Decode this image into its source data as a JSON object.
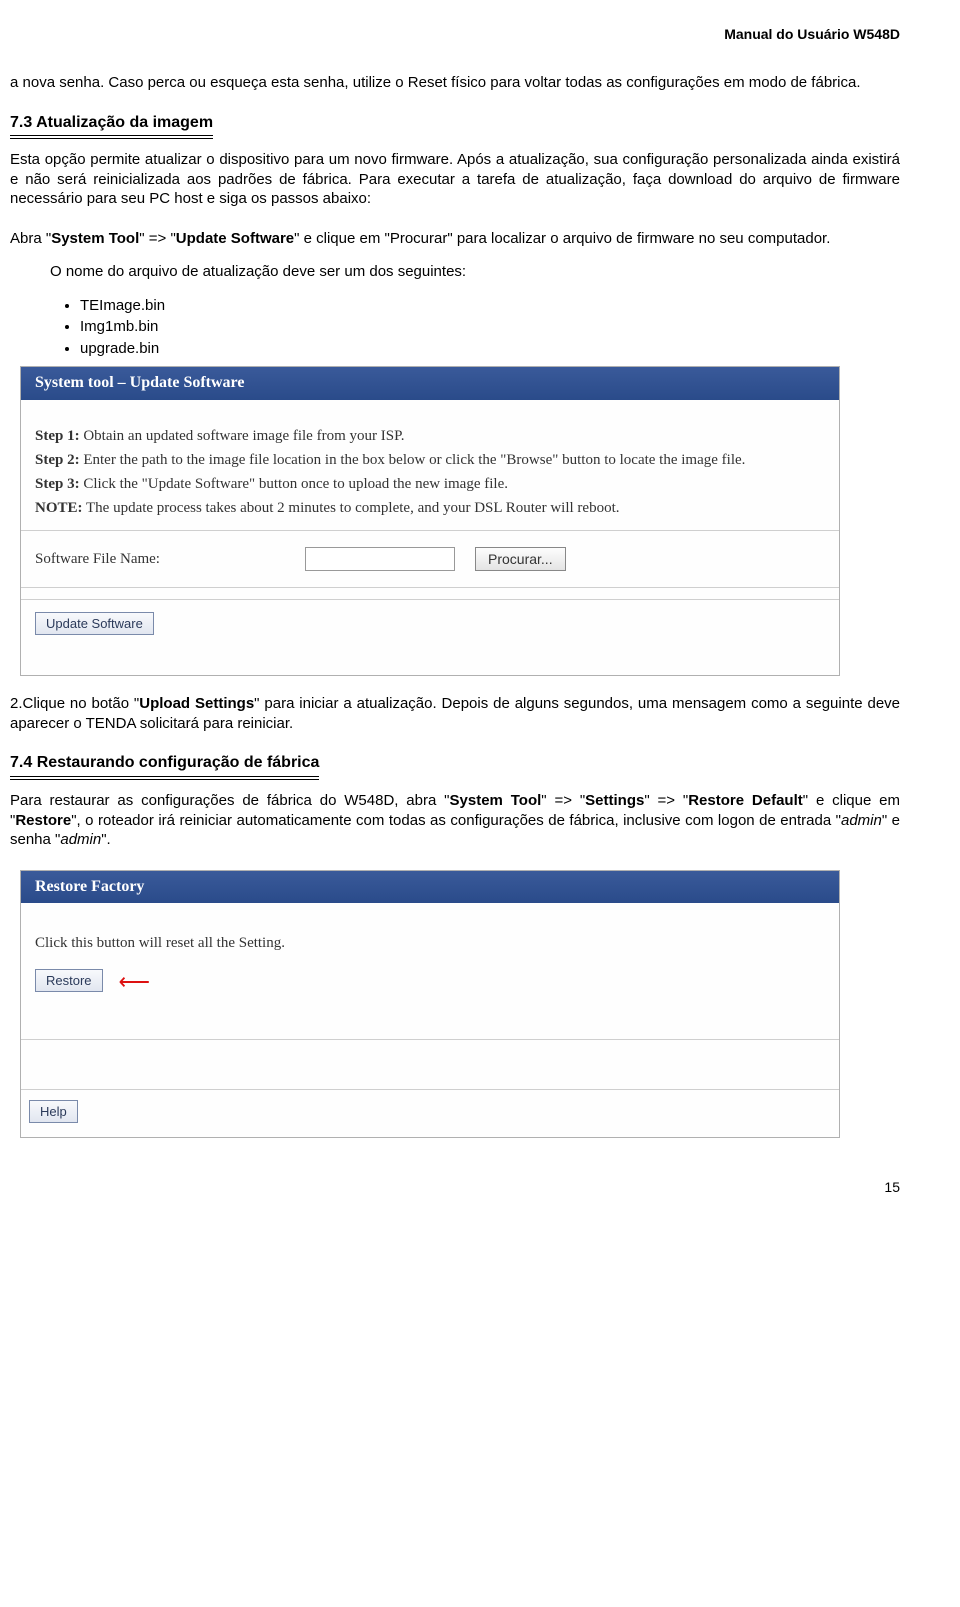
{
  "header": {
    "title": "Manual do Usuário W548D"
  },
  "intro": {
    "p1": "a nova senha. Caso perca ou esqueça esta senha, utilize o Reset físico para voltar todas as configurações em modo de fábrica."
  },
  "section73": {
    "title": "7.3 Atualização da imagem",
    "p1": "Esta opção permite atualizar o dispositivo para um novo firmware. Após a atualização, sua configuração personalizada ainda existirá e não será reinicializada aos padrões de fábrica. Para executar a tarefa de atualização, faça download do arquivo de firmware necessário para seu PC host e siga os passos abaixo:",
    "step_prefix": "Abra \"",
    "step_bold1": "System Tool",
    "step_mid1": "\" => \"",
    "step_bold2": "Update Software",
    "step_suffix": "\"   e clique em \"Procurar\" para localizar o arquivo de firmware no seu computador.",
    "names_intro": "O nome do arquivo de atualização deve ser um dos seguintes:",
    "bullets": [
      "TEImage.bin",
      "Img1mb.bin",
      "upgrade.bin"
    ]
  },
  "panel1": {
    "title": "System tool – Update Software",
    "step1_b": "Step 1:",
    "step1": " Obtain an updated software image file from your ISP.",
    "step2_b": "Step 2:",
    "step2": " Enter the path to the image file location in the box below or click the \"Browse\" button to locate the image file.",
    "step3_b": "Step 3:",
    "step3": " Click the \"Update Software\" button once to upload the new image file.",
    "note_b": "NOTE:",
    "note": " The update process takes about 2 minutes to complete, and your DSL Router will reboot.",
    "file_label": "Software File Name:",
    "browse": "Procurar...",
    "update_btn": "Update Software"
  },
  "postpanel": {
    "p_pre": "2.Clique no botão \"",
    "p_bold": "Upload Settings",
    "p_post": "\" para iniciar a atualização.  Depois de alguns segundos, uma mensagem como a seguinte deve aparecer o TENDA solicitará para reiniciar."
  },
  "section74": {
    "title": "7.4 Restaurando configuração de fábrica",
    "p_pre": "Para restaurar as configurações de fábrica do W548D, abra \"",
    "b1": "System Tool",
    "mid1": "\" => \"",
    "b2": "Settings",
    "mid2": "\" => \"",
    "b3": "Restore Default",
    "mid3": "\" e clique em \"",
    "b4": "Restore",
    "post": "\", o roteador irá reiniciar automaticamente com todas as configurações de fábrica, inclusive com logon de entrada \"",
    "i1": "admin",
    "mid4": "\" e senha \"",
    "i2": "admin",
    "end": "\"."
  },
  "panel2": {
    "title": "Restore Factory",
    "text": "Click this button will reset all the Setting.",
    "restore_btn": "Restore",
    "help_btn": "Help"
  },
  "page_number": "15"
}
